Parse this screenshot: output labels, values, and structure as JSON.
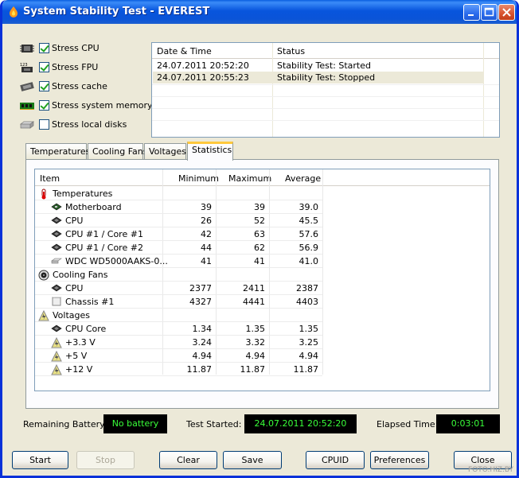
{
  "window": {
    "title": "System Stability Test - EVEREST"
  },
  "stress_options": [
    {
      "label": "Stress CPU",
      "checked": true,
      "icon": "cpu-chip-icon"
    },
    {
      "label": "Stress FPU",
      "checked": true,
      "icon": "fpu-chip-icon"
    },
    {
      "label": "Stress cache",
      "checked": true,
      "icon": "cache-chip-icon"
    },
    {
      "label": "Stress system memory",
      "checked": true,
      "icon": "memory-module-icon"
    },
    {
      "label": "Stress local disks",
      "checked": false,
      "icon": "disk-drive-icon"
    }
  ],
  "log": {
    "headers": {
      "datetime": "Date & Time",
      "status": "Status"
    },
    "rows": [
      {
        "datetime": "24.07.2011 20:52:20",
        "status": "Stability Test: Started"
      },
      {
        "datetime": "24.07.2011 20:55:23",
        "status": "Stability Test: Stopped"
      }
    ]
  },
  "tabs": [
    "Temperatures",
    "Cooling Fans",
    "Voltages",
    "Statistics"
  ],
  "active_tab": "Statistics",
  "stats": {
    "headers": {
      "item": "Item",
      "min": "Minimum",
      "max": "Maximum",
      "avg": "Average"
    },
    "rows": [
      {
        "type": "group",
        "item": "Temperatures",
        "icon": "thermometer-icon"
      },
      {
        "type": "item",
        "item": "Motherboard",
        "min": "39",
        "max": "39",
        "avg": "39.0",
        "icon": "motherboard-icon"
      },
      {
        "type": "item",
        "item": "CPU",
        "min": "26",
        "max": "52",
        "avg": "45.5",
        "icon": "cpu-icon"
      },
      {
        "type": "item",
        "item": "CPU #1 / Core #1",
        "min": "42",
        "max": "63",
        "avg": "57.6",
        "icon": "cpu-icon"
      },
      {
        "type": "item",
        "item": "CPU #1 / Core #2",
        "min": "44",
        "max": "62",
        "avg": "56.9",
        "icon": "cpu-icon"
      },
      {
        "type": "item",
        "item": "WDC WD5000AAKS-0...",
        "min": "41",
        "max": "41",
        "avg": "41.0",
        "icon": "hard-disk-icon"
      },
      {
        "type": "group",
        "item": "Cooling Fans",
        "icon": "fan-icon"
      },
      {
        "type": "item",
        "item": "CPU",
        "min": "2377",
        "max": "2411",
        "avg": "2387",
        "icon": "cpu-icon"
      },
      {
        "type": "item",
        "item": "Chassis #1",
        "min": "4327",
        "max": "4441",
        "avg": "4403",
        "icon": "chassis-icon"
      },
      {
        "type": "group",
        "item": "Voltages",
        "icon": "voltage-icon"
      },
      {
        "type": "item",
        "item": "CPU Core",
        "min": "1.34",
        "max": "1.35",
        "avg": "1.35",
        "icon": "cpu-icon"
      },
      {
        "type": "item",
        "item": "+3.3 V",
        "min": "3.24",
        "max": "3.32",
        "avg": "3.25",
        "icon": "voltage-icon"
      },
      {
        "type": "item",
        "item": "+5 V",
        "min": "4.94",
        "max": "4.94",
        "avg": "4.94",
        "icon": "voltage-icon"
      },
      {
        "type": "item",
        "item": "+12 V",
        "min": "11.87",
        "max": "11.87",
        "avg": "11.87",
        "icon": "voltage-icon"
      }
    ]
  },
  "status": {
    "battery_label": "Remaining Battery:",
    "battery_value": "No battery",
    "started_label": "Test Started:",
    "started_value": "24.07.2011 20:52:20",
    "elapsed_label": "Elapsed Time:",
    "elapsed_value": "0:03:01"
  },
  "buttons": {
    "start": "Start",
    "stop": "Stop",
    "clear": "Clear",
    "save": "Save",
    "cpuid": "CPUID",
    "preferences": "Preferences",
    "close": "Close"
  },
  "watermark": "FOTO.HIZ.BY",
  "colors": {
    "lcd_text": "#39ff39",
    "lcd_bg": "#000000",
    "title_bar": "#0a54d8",
    "active_tab_accent": "#ffc83c"
  }
}
